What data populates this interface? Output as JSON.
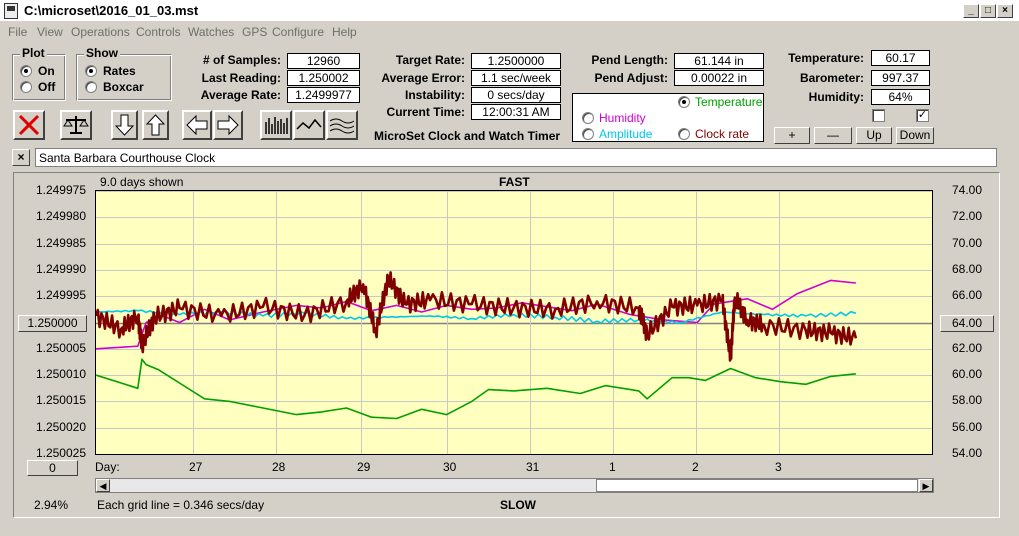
{
  "window": {
    "title": "C:\\microset\\2016_01_03.mst",
    "min": "_",
    "max": "□",
    "close": "×"
  },
  "menu": [
    "File",
    "View",
    "Operations",
    "Controls",
    "Watches",
    "GPS",
    "Configure",
    "Help"
  ],
  "plot_group": {
    "title": "Plot",
    "on": "On",
    "off": "Off",
    "selected": "On"
  },
  "show_group": {
    "title": "Show",
    "rates": "Rates",
    "boxcar": "Boxcar",
    "selected": "Rates"
  },
  "stats": {
    "samples_label": "# of Samples:",
    "samples": "12960",
    "last_reading_label": "Last Reading:",
    "last_reading": "1.250002",
    "avg_rate_label": "Average Rate:",
    "avg_rate": "1.2499977",
    "target_rate_label": "Target Rate:",
    "target_rate": "1.2500000",
    "avg_error_label": "Average Error:",
    "avg_error": "1.1 sec/week",
    "instability_label": "Instability:",
    "instability": "0 secs/day",
    "current_time_label": "Current Time:",
    "current_time": "12:00:31 AM",
    "pend_length_label": "Pend Length:",
    "pend_length": "61.144 in",
    "pend_adjust_label": "Pend Adjust:",
    "pend_adjust": "0.00022 in",
    "temperature_label": "Temperature:",
    "temperature": "60.17",
    "barometer_label": "Barometer:",
    "barometer": "997.37",
    "humidity_label": "Humidity:",
    "humidity": "64%"
  },
  "app_name": "MicroSet Clock and Watch Timer",
  "series_select": {
    "temperature": "Temperature",
    "humidity": "Humidity",
    "amplitude": "Amplitude",
    "clock_rate": "Clock rate",
    "selected": "Temperature",
    "colors": {
      "temperature": "#00a000",
      "humidity": "#d000d0",
      "amplitude": "#00c8e8",
      "clock_rate": "#800000"
    }
  },
  "adjust_buttons": {
    "plus": "+",
    "minus": "—",
    "up": "Up",
    "down": "Down"
  },
  "checkboxes": {
    "first": false,
    "second": true,
    "second_mark": "✓"
  },
  "clock_name": {
    "close": "×",
    "value": "Santa Barbara Courthouse Clock"
  },
  "chart_labels": {
    "days_shown": "9.0 days shown",
    "fast": "FAST",
    "slow": "SLOW",
    "grid_note": "Each grid line = 0.346 secs/day",
    "percent": "2.94%",
    "left_button": "1.250000",
    "right_button": "64.00",
    "bottom_button": "0",
    "day_label": "Day:"
  },
  "chart_data": {
    "type": "line",
    "x_ticks": [
      "27",
      "28",
      "29",
      "30",
      "31",
      "1",
      "2",
      "3"
    ],
    "x_range": [
      26.35,
      4.95
    ],
    "y_left_ticks": [
      "1.249975",
      "1.249980",
      "1.249985",
      "1.249990",
      "1.249995",
      "1.250000",
      "1.250005",
      "1.250010",
      "1.250015",
      "1.250020",
      "1.250025"
    ],
    "y_left_range": [
      1.250025,
      1.249975
    ],
    "y_right_ticks": [
      "74.00",
      "72.00",
      "70.00",
      "68.00",
      "66.00",
      "64.00",
      "62.00",
      "60.00",
      "58.00",
      "56.00",
      "54.00"
    ],
    "y_right_range": [
      54,
      74
    ],
    "grid": true,
    "series": [
      {
        "key": "temperature",
        "axis": "right",
        "x": [
          0,
          0.3,
          0.5,
          0.55,
          0.6,
          0.75,
          1.0,
          1.3,
          1.6,
          2.0,
          2.4,
          2.7,
          3.0,
          3.3,
          3.6,
          3.9,
          4.2,
          4.5,
          4.7,
          5.0,
          5.4,
          5.8,
          6.1,
          6.5,
          6.6,
          6.9,
          7.1,
          7.3,
          7.6,
          7.9,
          8.2,
          8.5,
          8.8,
          9.1
        ],
        "y": [
          60.0,
          59.4,
          59.0,
          61.2,
          60.8,
          60.4,
          59.4,
          58.2,
          58.0,
          57.5,
          57.0,
          57.2,
          57.5,
          56.8,
          56.7,
          57.4,
          57.0,
          58.0,
          58.9,
          58.8,
          59.0,
          58.6,
          59.2,
          58.8,
          58.2,
          59.8,
          59.8,
          59.6,
          60.5,
          59.8,
          59.5,
          59.3,
          59.9,
          60.1
        ]
      },
      {
        "key": "humidity",
        "axis": "right",
        "x": [
          0,
          0.5,
          0.6,
          0.8,
          1.0,
          1.3,
          1.6,
          2.0,
          2.4,
          2.7,
          3.0,
          3.3,
          3.6,
          3.9,
          4.2,
          4.5,
          4.8,
          5.1,
          5.4,
          5.7,
          6.0,
          6.4,
          6.8,
          7.2,
          7.4,
          7.8,
          8.1,
          8.4,
          8.8,
          9.1
        ],
        "y": [
          62.0,
          62.2,
          64.0,
          64.5,
          64.0,
          65.0,
          64.2,
          64.8,
          65.3,
          65.1,
          65.6,
          64.9,
          65.3,
          64.8,
          65.3,
          65.0,
          65.1,
          65.5,
          65.2,
          64.9,
          65.4,
          64.6,
          64.2,
          64.0,
          65.4,
          65.8,
          65.0,
          66.2,
          67.2,
          67.0
        ]
      },
      {
        "key": "amplitude",
        "axis": "right",
        "x": [
          0,
          0.5,
          1.0,
          1.5,
          2.0,
          2.5,
          3.0,
          3.5,
          4.0,
          4.5,
          5.0,
          5.5,
          6.0,
          6.5,
          7.0,
          7.5,
          8.0,
          8.5,
          9.1
        ],
        "y": [
          64.8,
          64.9,
          64.6,
          64.8,
          64.5,
          64.7,
          64.3,
          64.4,
          64.5,
          64.3,
          64.6,
          64.4,
          64.1,
          64.2,
          64.0,
          64.8,
          64.6,
          64.5,
          64.7
        ]
      },
      {
        "key": "clock_rate",
        "axis": "right",
        "x": [
          0,
          0.3,
          0.5,
          0.55,
          0.7,
          1.0,
          1.5,
          2.0,
          2.5,
          3.0,
          3.2,
          3.35,
          3.5,
          3.7,
          4.0,
          4.5,
          5.0,
          5.5,
          6.0,
          6.5,
          6.6,
          6.9,
          7.2,
          7.5,
          7.6,
          7.65,
          7.8,
          8.0,
          8.5,
          8.8,
          9.1
        ],
        "y": [
          64.5,
          63.5,
          64.5,
          62.3,
          64.4,
          65.1,
          64.5,
          65.2,
          64.6,
          65.6,
          66.9,
          63.3,
          67.4,
          65.4,
          65.7,
          65.4,
          65.1,
          65.0,
          65.6,
          65.1,
          63.1,
          65.2,
          65.3,
          65.7,
          61.3,
          65.9,
          64.2,
          63.8,
          63.4,
          63.2,
          62.8
        ]
      }
    ]
  }
}
